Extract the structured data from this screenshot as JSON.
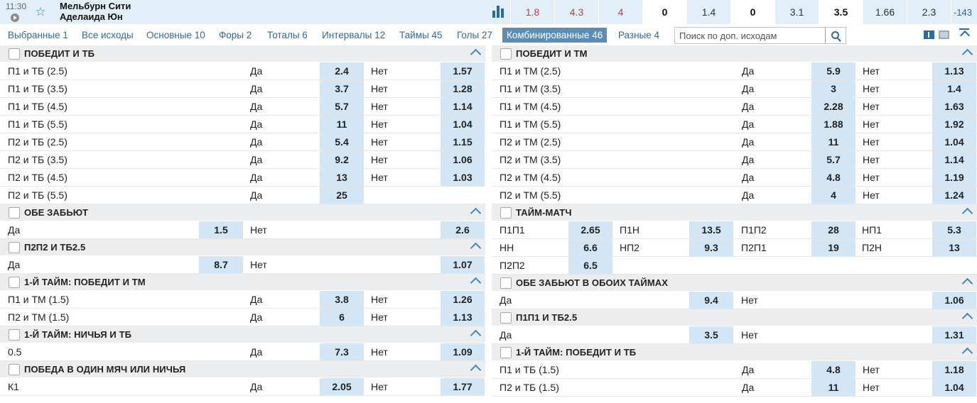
{
  "header": {
    "time": "11:30",
    "team_home": "Мельбурн Сити",
    "team_away": "Аделаида Юн",
    "odds": [
      {
        "v": "1.8",
        "s": "red"
      },
      {
        "v": "4.3",
        "s": "red"
      },
      {
        "v": "4",
        "s": "red"
      },
      {
        "v": "0",
        "s": "white"
      },
      {
        "v": "1.4",
        "s": "blue"
      },
      {
        "v": "0",
        "s": "white"
      },
      {
        "v": "3.1",
        "s": "blue"
      },
      {
        "v": "3.5",
        "s": "white"
      },
      {
        "v": "1.66",
        "s": "blue"
      },
      {
        "v": "2.3",
        "s": "blue"
      },
      {
        "v": "-143",
        "s": "more"
      }
    ]
  },
  "tabs": [
    "Выбранные 1",
    "Все исходы",
    "Основные 10",
    "Форы 2",
    "Тоталы 6",
    "Интервалы 12",
    "Таймы 45",
    "Голы 27",
    "Комбинированные 46",
    "Разные 4"
  ],
  "active_tab": 8,
  "search": {
    "placeholder": "Поиск по доп. исходам"
  },
  "left_markets": [
    {
      "title": "ПОБЕДИТ И ТБ",
      "layout": "std",
      "rows": [
        [
          "П1 и ТБ (2.5)",
          "Да",
          "2.4",
          "Нет",
          "1.57"
        ],
        [
          "П1 и ТБ (3.5)",
          "Да",
          "3.7",
          "Нет",
          "1.28"
        ],
        [
          "П1 и ТБ (4.5)",
          "Да",
          "5.7",
          "Нет",
          "1.14"
        ],
        [
          "П1 и ТБ (5.5)",
          "Да",
          "11",
          "Нет",
          "1.04"
        ],
        [
          "П2 и ТБ (2.5)",
          "Да",
          "5.4",
          "Нет",
          "1.15"
        ],
        [
          "П2 и ТБ (3.5)",
          "Да",
          "9.2",
          "Нет",
          "1.06"
        ],
        [
          "П2 и ТБ (4.5)",
          "Да",
          "13",
          "Нет",
          "1.03"
        ],
        [
          "П2 и ТБ (5.5)",
          "Да",
          "25"
        ]
      ]
    },
    {
      "title": "ОБЕ ЗАБЬЮТ",
      "layout": "yn",
      "rows": [
        [
          "Да",
          "1.5",
          "Нет",
          "2.6"
        ]
      ]
    },
    {
      "title": "П2П2 И ТБ2.5",
      "layout": "yn",
      "rows": [
        [
          "Да",
          "8.7",
          "Нет",
          "1.07"
        ]
      ]
    },
    {
      "title": "1-Й ТАЙМ: ПОБЕДИТ И ТМ",
      "layout": "std",
      "rows": [
        [
          "П1 и ТМ (1.5)",
          "Да",
          "3.8",
          "Нет",
          "1.26"
        ],
        [
          "П2 и ТМ (1.5)",
          "Да",
          "6",
          "Нет",
          "1.13"
        ]
      ]
    },
    {
      "title": "1-Й ТАЙМ: НИЧЬЯ И ТБ",
      "layout": "std",
      "rows": [
        [
          "0.5",
          "Да",
          "7.3",
          "Нет",
          "1.09"
        ]
      ]
    },
    {
      "title": "ПОБЕДА В ОДИН МЯЧ ИЛИ НИЧЬЯ",
      "layout": "std",
      "rows": [
        [
          "К1",
          "Да",
          "2.05",
          "Нет",
          "1.77"
        ]
      ]
    }
  ],
  "right_markets": [
    {
      "title": "ПОБЕДИТ И ТМ",
      "layout": "std",
      "rows": [
        [
          "П1 и ТМ (2.5)",
          "Да",
          "5.9",
          "Нет",
          "1.13"
        ],
        [
          "П1 и ТМ (3.5)",
          "Да",
          "3",
          "Нет",
          "1.4"
        ],
        [
          "П1 и ТМ (4.5)",
          "Да",
          "2.28",
          "Нет",
          "1.63"
        ],
        [
          "П1 и ТМ (5.5)",
          "Да",
          "1.88",
          "Нет",
          "1.92"
        ],
        [
          "П2 и ТМ (2.5)",
          "Да",
          "11",
          "Нет",
          "1.04"
        ],
        [
          "П2 и ТМ (3.5)",
          "Да",
          "5.7",
          "Нет",
          "1.14"
        ],
        [
          "П2 и ТМ (4.5)",
          "Да",
          "4.8",
          "Нет",
          "1.19"
        ],
        [
          "П2 и ТМ (5.5)",
          "Да",
          "4",
          "Нет",
          "1.24"
        ]
      ]
    },
    {
      "title": "ТАЙМ-МАТЧ",
      "layout": "four",
      "rows": [
        [
          "П1П1",
          "2.65",
          "П1Н",
          "13.5",
          "П1П2",
          "28",
          "НП1",
          "5.3"
        ],
        [
          "НН",
          "6.6",
          "НП2",
          "9.3",
          "П2П1",
          "19",
          "П2Н",
          "13"
        ],
        [
          "П2П2",
          "6.5"
        ]
      ]
    },
    {
      "title": "ОБЕ ЗАБЬЮТ В ОБОИХ ТАЙМАХ",
      "layout": "yn2",
      "rows": [
        [
          "Да",
          "9.4",
          "Нет",
          "1.06"
        ]
      ]
    },
    {
      "title": "П1П1 И ТБ2.5",
      "layout": "yn3",
      "rows": [
        [
          "Да",
          "3.5",
          "Нет",
          "1.31"
        ]
      ]
    },
    {
      "title": "1-Й ТАЙМ: ПОБЕДИТ И ТБ",
      "layout": "std",
      "rows": [
        [
          "П1 и ТБ (1.5)",
          "Да",
          "4.8",
          "Нет",
          "1.18"
        ],
        [
          "П2 и ТБ (1.5)",
          "Да",
          "11",
          "Нет",
          "1.04"
        ]
      ]
    }
  ]
}
